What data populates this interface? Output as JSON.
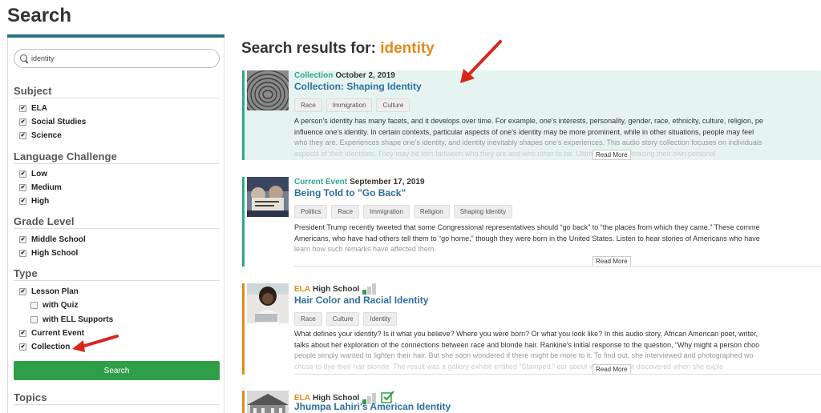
{
  "page": {
    "title": "Search"
  },
  "search": {
    "value": "identity"
  },
  "filters": {
    "subject": {
      "title": "Subject",
      "items": [
        {
          "label": "ELA"
        },
        {
          "label": "Social Studies"
        },
        {
          "label": "Science"
        }
      ]
    },
    "language": {
      "title": "Language Challenge",
      "items": [
        {
          "label": "Low"
        },
        {
          "label": "Medium"
        },
        {
          "label": "High"
        }
      ]
    },
    "grade": {
      "title": "Grade Level",
      "items": [
        {
          "label": "Middle School"
        },
        {
          "label": "High School"
        }
      ]
    },
    "type": {
      "title": "Type",
      "items": [
        {
          "label": "Lesson Plan",
          "checked": true
        },
        {
          "label": "with Quiz",
          "checked": false
        },
        {
          "label": "with ELL Supports",
          "checked": false
        },
        {
          "label": "Current Event",
          "checked": true
        },
        {
          "label": "Collection",
          "checked": true
        }
      ]
    },
    "search_button": "Search",
    "topics_title": "Topics"
  },
  "results_header": {
    "prefix": "Search results for:",
    "term": "identity"
  },
  "results": [
    {
      "kind": "Collection",
      "date": "October 2, 2019",
      "title": "Collection: Shaping Identity",
      "tags": [
        "Race",
        "Immigration",
        "Culture"
      ],
      "desc": [
        "A person's identity has many facets, and it develops over time. For example, one's interests, personality, gender, race, ethnicity, culture, religion, pe",
        "influence one's identity. In certain contexts, particular aspects of one's identity may be more prominent, while in other situations, people may feel",
        "who they are. Experiences shape one's identity, and identity inevitably shapes one's experiences. This audio story collection focuses on individuals",
        "aspects of their identities. They may be torn between who they are and who other          to be. Ultimately, by embracing their own personal"
      ],
      "read_more": "Read More"
    },
    {
      "kind": "Current Event",
      "date": "September 17, 2019",
      "title": "Being Told to \"Go Back\"",
      "tags": [
        "Politics",
        "Race",
        "Immigration",
        "Religion",
        "Shaping Identity"
      ],
      "desc": [
        "President Trump recently tweeted that some Congressional representatives should “go back” to “the places from which they came.” These comme",
        "Americans, who have had others tell them to “go home,” though they were born in the United States. Listen to hear stories of Americans who have",
        "learn how such remarks have affected them."
      ],
      "read_more": "Read More"
    },
    {
      "subject": "ELA",
      "grade": "High School",
      "title": "Hair Color and Racial Identity",
      "tags": [
        "Race",
        "Culture",
        "Identity"
      ],
      "desc": [
        "What defines your identity? Is it what you believe? Where you were born? Or what you look like? In this audio story, African American poet, writer,",
        "talks about her exploration of the connections between race and blonde hair. Rankine's initial response to the question, “Why might a person choo",
        "people simply wanted to lighten their hair. But she soon wondered if there might be more to it. To find out, she interviewed and photographed wo",
        "chose to dye their hair blonde. The result was a gallery exhibit entitled “Stamped.”          ear about what the artist discovered when she explo"
      ],
      "read_more": "Read More"
    },
    {
      "subject": "ELA",
      "grade": "High School",
      "title": "Jhumpa Lahiri's American Identity"
    }
  ],
  "colors": {
    "accent_blue": "#2e6f86",
    "teal": "#2fa88a",
    "orange": "#e38a1a",
    "green": "#2f9e48",
    "arrow_red": "#d9261c",
    "highlight_bg": "#e6f4f1"
  }
}
